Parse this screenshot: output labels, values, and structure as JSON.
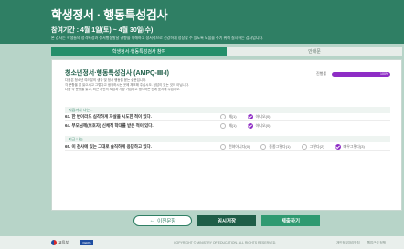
{
  "header": {
    "title": "학생정서 · 행동특성검사",
    "period": "참여기간 : 4월 1일(토) ~ 4월 30일(수)",
    "desc": "본 검사는 학생들의 성격특성과 정서행동발달 경향을 이해하고 정서적으로 건강하게 성장할 수 있도록 도움을 주기 위해 실시하는 검사입니다."
  },
  "tabs": {
    "active": "학생정서·행동특성검사 참여",
    "inactive": "안내문"
  },
  "survey": {
    "title": "청소년정서·행동특성검사 (AMPQ-Ⅲ-I)",
    "notes": [
      "다음은 청소년 여러분의 생각 및 정서 행동을 묻는 설문입니다.",
      "각 문항을 잘 읽으시고 그렇다고 생각하시는 곳에 체크해 주십시오. 정답이 있는 것이 아닙니다.",
      "다음 각 문항을 읽고, 최근 자신의 모습과 가장 가깝다고 생각하는 칸에 표시해 주십시오."
    ],
    "progress_label": "진행률",
    "progress_pct": "100%",
    "progress_value": 1.0
  },
  "sections": [
    {
      "head": "지금까지 나는...",
      "questions": [
        {
          "text": "63. 한 번이라도 심각하게 자살을 시도한 적이 있다.",
          "options": [
            "예(1)",
            "아니오(0)"
          ],
          "selected": 1
        },
        {
          "text": "64. 부모님께(보호자) 신체적 학대를 받은 적이 있다.",
          "options": [
            "예(1)",
            "아니오(0)"
          ],
          "selected": 1
        }
      ]
    },
    {
      "head": "지금 나는...",
      "questions": [
        {
          "text": "65. 이 검사에 있는 그대로 솔직하게 응답하고 있다.",
          "options": [
            "전혀아니다(0)",
            "종종그렇다(1)",
            "그렇다(2)",
            "매우그렇다(3)"
          ],
          "selected": 3
        }
      ]
    }
  ],
  "buttons": {
    "prev": "이전문항",
    "save": "임시저장",
    "submit": "제출하기"
  },
  "footer": {
    "logo1": "교육부",
    "logo2": "KERIS",
    "copyright": "COPYRIGHT © MINISTRY OF EDUCATION. ALL RIGHTS RESERVED.",
    "links": [
      "개인정보처리방침",
      "웹접근성 정책"
    ]
  }
}
